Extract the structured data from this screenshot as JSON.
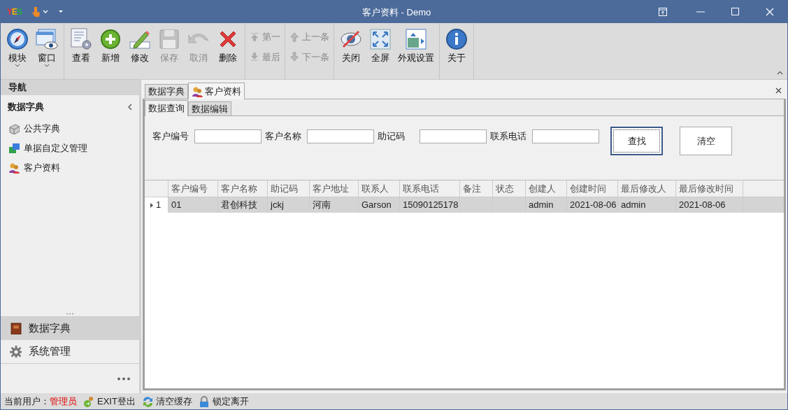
{
  "window": {
    "logo": "YES",
    "title": "客户资料 - Demo"
  },
  "ribbon": {
    "groups": [
      {
        "buttons": [
          {
            "label": "模块",
            "kind": "compass",
            "disabled": false,
            "dropdown": true
          },
          {
            "label": "窗口",
            "kind": "windows",
            "disabled": false,
            "dropdown": true
          }
        ]
      },
      {
        "buttons": [
          {
            "label": "查看",
            "kind": "view",
            "disabled": false,
            "dropdown": false
          },
          {
            "label": "新增",
            "kind": "add",
            "disabled": false,
            "dropdown": false
          },
          {
            "label": "修改",
            "kind": "edit",
            "disabled": false,
            "dropdown": false
          },
          {
            "label": "保存",
            "kind": "save",
            "disabled": true,
            "dropdown": false
          },
          {
            "label": "取消",
            "kind": "undo",
            "disabled": true,
            "dropdown": false
          },
          {
            "label": "删除",
            "kind": "delete",
            "disabled": false,
            "dropdown": false
          }
        ]
      },
      {
        "small": [
          {
            "label": "第一",
            "kind": "first",
            "disabled": true
          },
          {
            "label": "最后",
            "kind": "last",
            "disabled": true
          }
        ]
      },
      {
        "small": [
          {
            "label": "上一条",
            "kind": "up",
            "disabled": true
          },
          {
            "label": "下一条",
            "kind": "down",
            "disabled": true
          }
        ]
      },
      {
        "buttons": [
          {
            "label": "关闭",
            "kind": "hide",
            "disabled": false,
            "dropdown": false
          },
          {
            "label": "全屏",
            "kind": "fullscreen",
            "disabled": false,
            "dropdown": false
          },
          {
            "label": "外观设置",
            "kind": "layout",
            "disabled": false,
            "dropdown": false
          }
        ]
      },
      {
        "buttons": [
          {
            "label": "关于",
            "kind": "info",
            "disabled": false,
            "dropdown": false
          }
        ]
      }
    ]
  },
  "nav": {
    "header": "导航",
    "section": "数据字典",
    "items": [
      {
        "label": "公共字典",
        "kind": "box"
      },
      {
        "label": "单据自定义管理",
        "kind": "forms"
      },
      {
        "label": "客户资料",
        "kind": "people"
      }
    ],
    "panels": [
      {
        "label": "数据字典",
        "kind": "book",
        "selected": true
      },
      {
        "label": "系统管理",
        "kind": "gear",
        "selected": false
      }
    ]
  },
  "doc_tabs": [
    {
      "label": "数据字典",
      "kind": "plain",
      "selected": false
    },
    {
      "label": "客户资料",
      "kind": "people",
      "selected": true
    }
  ],
  "sub_tabs": [
    {
      "label": "数据查询",
      "selected": true
    },
    {
      "label": "数据编辑",
      "selected": false
    }
  ],
  "search_fields": [
    {
      "label": "客户编号"
    },
    {
      "label": "客户名称"
    },
    {
      "label": "助记码"
    },
    {
      "label": "联系电话"
    }
  ],
  "search_buttons": [
    {
      "label": "查找",
      "focused": true
    },
    {
      "label": "清空",
      "focused": false
    }
  ],
  "table": {
    "columns": [
      "客户编号",
      "客户名称",
      "助记码",
      "客户地址",
      "联系人",
      "联系电话",
      "备注",
      "状态",
      "创建人",
      "创建时间",
      "最后修改人",
      "最后修改时间"
    ],
    "rows": [
      {
        "number": "1",
        "selected": true,
        "cells": [
          "01",
          "君创科技",
          "jckj",
          "河南",
          "Garson",
          "15090125178",
          "",
          "",
          "admin",
          "2021-08-06",
          "admin",
          "2021-08-06"
        ]
      }
    ]
  },
  "status_bar": {
    "user_label": "当前用户：",
    "user": "管理员",
    "actions": [
      {
        "label": "EXIT登出",
        "kind": "exit"
      },
      {
        "label": "清空缓存",
        "kind": "refresh"
      },
      {
        "label": "锁定离开",
        "kind": "lock"
      }
    ]
  }
}
